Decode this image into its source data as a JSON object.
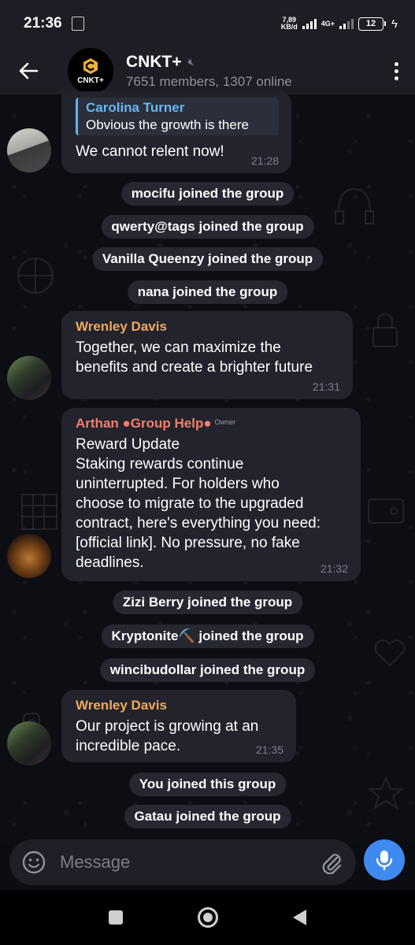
{
  "status_bar": {
    "time": "21:36",
    "net_speed_value": "7,89",
    "net_speed_unit": "KB/d",
    "network": "4G+",
    "battery": "12"
  },
  "header": {
    "group_name": "CNKT+",
    "subtitle": "7651 members, 1307 online",
    "avatar_text": "CNKT+",
    "icons": [
      "back-arrow-icon",
      "mute-icon",
      "more-vert-icon"
    ]
  },
  "messages": [
    {
      "reply": {
        "name": "Carolina Turner",
        "text": "Obvious the growth is there"
      },
      "text": "We cannot relent now!",
      "time": "21:28"
    },
    {
      "sender": "Wrenley Davis",
      "text": "Together, we can maximize the\nbenefits and create a brighter future",
      "time": "21:31"
    },
    {
      "sender": "Arthan ●Group Help●",
      "badge": "Owner",
      "text": "Reward Update\nStaking rewards continue\nuninterrupted. For holders who\nchoose to migrate to the upgraded\ncontract, here's everything you need:\n[official link]. No pressure, no fake\ndeadlines.",
      "time": "21:32"
    },
    {
      "sender": "Wrenley Davis",
      "text": "Our project is growing at an\nincredible pace.",
      "time": "21:35"
    }
  ],
  "service_messages": [
    "mocifu joined the group",
    "qwerty@tags joined the group",
    "Vanilla Queenzy joined the group",
    "nana joined the group",
    "Zizi Berry joined the group",
    "Kryptonite⛏️ joined the group",
    "wincibudollar joined the group",
    "You joined this group",
    "Gatau joined the group"
  ],
  "composer": {
    "placeholder": "Message",
    "icons": [
      "emoji-icon",
      "attach-icon",
      "mic-icon"
    ]
  },
  "colors": {
    "accent": "#3f8aef",
    "sender_orange": "#f0a95c",
    "owner_red": "#f77e6a",
    "reply_blue": "#66b6f0",
    "bubble": "#22232c"
  }
}
